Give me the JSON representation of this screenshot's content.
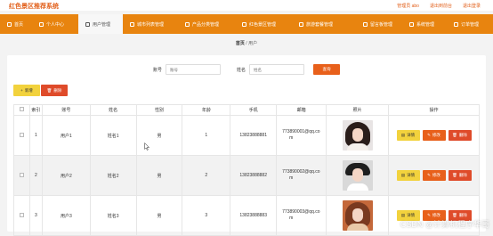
{
  "header": {
    "brand": "红色景区推荐系统",
    "admin": "管理员 abo",
    "exit_to_frontend": "退出到前台",
    "logout": "退出登录"
  },
  "nav": {
    "items": [
      {
        "label": "首页",
        "icon": "home-icon"
      },
      {
        "label": "个人中心",
        "icon": "user-icon"
      },
      {
        "label": "用户管理",
        "icon": "users-icon"
      },
      {
        "label": "城市列表管理",
        "icon": "list-icon"
      },
      {
        "label": "产品分类管理",
        "icon": "category-icon"
      },
      {
        "label": "红色景区管理",
        "icon": "landscape-icon"
      },
      {
        "label": "旅游套餐管理",
        "icon": "package-icon"
      },
      {
        "label": "留言板管理",
        "icon": "message-icon"
      },
      {
        "label": "系统管理",
        "icon": "settings-icon"
      },
      {
        "label": "订单管理",
        "icon": "order-icon"
      }
    ],
    "active_index": 2
  },
  "breadcrumb": {
    "home": "首页",
    "sep": "/",
    "current": "用户"
  },
  "search": {
    "account_label": "账号",
    "account_placeholder": "账号",
    "name_label": "姓名",
    "name_placeholder": "姓名",
    "button": "查询"
  },
  "actions": {
    "add": "新增",
    "delete": "删除"
  },
  "table": {
    "headers": [
      "",
      "索引",
      "账号",
      "姓名",
      "性别",
      "年龄",
      "手机",
      "邮箱",
      "照片",
      "操作"
    ],
    "rows": [
      {
        "index": "1",
        "account": "用户1",
        "name": "姓名1",
        "gender": "男",
        "age": "1",
        "phone": "13823888881",
        "email_1": "773890001@qq.co",
        "email_2": "m"
      },
      {
        "index": "2",
        "account": "用户2",
        "name": "姓名2",
        "gender": "男",
        "age": "2",
        "phone": "13823888882",
        "email_1": "773890002@qq.co",
        "email_2": "m"
      },
      {
        "index": "3",
        "account": "用户3",
        "name": "姓名3",
        "gender": "男",
        "age": "3",
        "phone": "13823888883",
        "email_1": "773890003@qq.co",
        "email_2": "m"
      }
    ],
    "ops": {
      "detail": "详情",
      "edit": "修改",
      "delete": "删除"
    }
  },
  "watermark": "CSDN @计算机程序华哥",
  "colors": {
    "accent": "#e8840f",
    "primary": "#e8601b",
    "danger": "#df4b2a",
    "warning": "#f2d23d"
  }
}
